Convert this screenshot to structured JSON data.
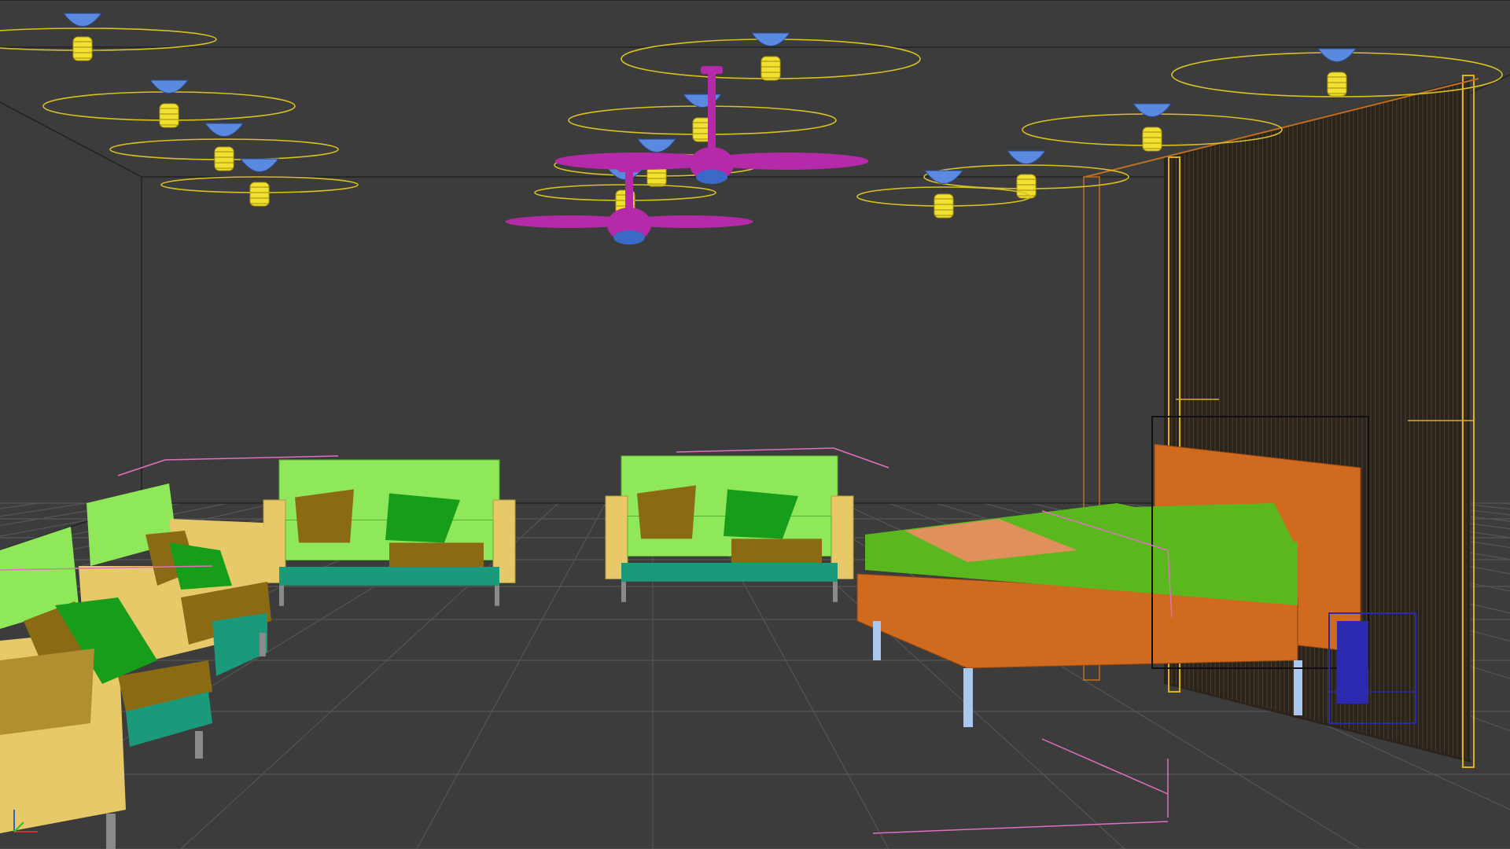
{
  "viewport": {
    "background": "#3c3c3c",
    "grid_color": "#555555",
    "room_edge_color": "#222222"
  },
  "colors": {
    "sofa_frame": "#e8c96a",
    "sofa_fabric": "#8fe85a",
    "pillow_brown": "#8b6a14",
    "pillow_green": "#169e1a",
    "sofa_base": "#1a9a7a",
    "bed_frame": "#d06a1e",
    "bed_sheet": "#5ab81e",
    "bed_blanket": "#e0905a",
    "bed_legs": "#a9c8f0",
    "fan": "#b52aa8",
    "fan_hub": "#3a6ac8",
    "light_cap": "#5a8ae0",
    "light_cage": "#f0e030",
    "light_ring": "#d8c020",
    "curtain": "#2a241c",
    "curtain_edge": "#e0b018",
    "nightstand": "#2a2ab0",
    "helper_pink": "#e070c0"
  },
  "icons": {
    "axis_gizmo": "axis-tripod-icon"
  }
}
